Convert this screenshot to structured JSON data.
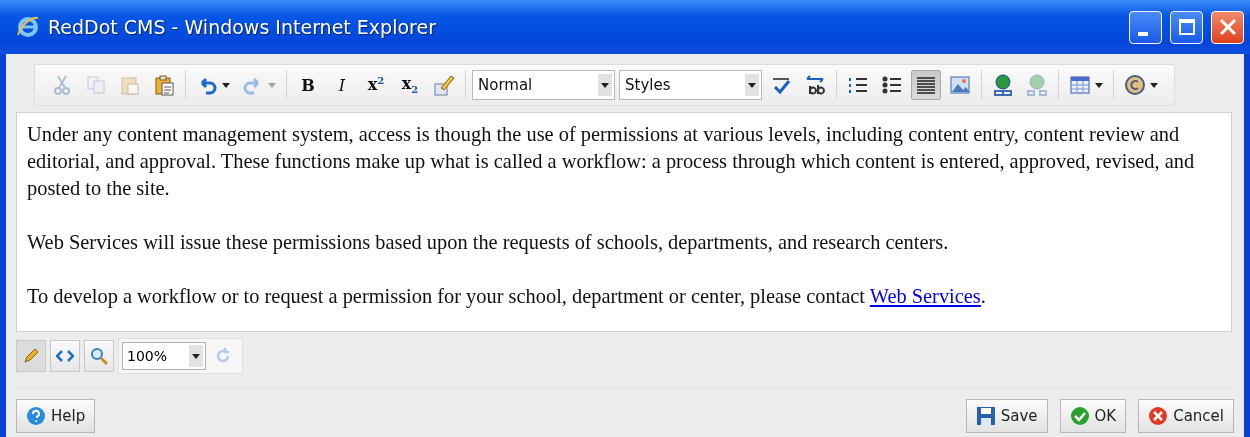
{
  "window": {
    "title": "RedDot CMS - Windows Internet Explorer"
  },
  "toolbar": [
    [
      {
        "kind": "button",
        "disabled": true,
        "pressed": false
      },
      {
        "kind": "button",
        "disabled": true,
        "pressed": false
      },
      {
        "kind": "button",
        "disabled": true,
        "pressed": false
      },
      {
        "kind": "button",
        "disabled": false,
        "pressed": false
      }
    ],
    [
      {
        "kind": "menubutton",
        "disabled": false,
        "pressed": false
      },
      {
        "kind": "menubutton",
        "disabled": true,
        "pressed": false
      }
    ],
    [
      {
        "kind": "glyph",
        "glyph": "B",
        "disabled": false,
        "pressed": false
      },
      {
        "kind": "glyph",
        "glyph": "I",
        "disabled": false,
        "pressed": false
      },
      {
        "kind": "glyph",
        "glyph": "x$^{2}$",
        "disabled": false,
        "pressed": false
      },
      {
        "kind": "glyph",
        "glyph": "x$_{2}$",
        "disabled": false,
        "pressed": false
      },
      {
        "kind": "button",
        "disabled": false,
        "pressed": false
      }
    ],
    [
      {
        "kind": "select",
        "value": "Normal"
      },
      {
        "kind": "select",
        "value": "Styles"
      },
      {
        "kind": "button",
        "disabled": false,
        "pressed": false
      },
      {
        "kind": "button",
        "disabled": false,
        "pressed": false
      }
    ],
    [
      {
        "kind": "button",
        "disabled": false,
        "pressed": false
      },
      {
        "kind": "button",
        "disabled": false,
        "pressed": false
      },
      {
        "kind": "button",
        "disabled": false,
        "pressed": true
      },
      {
        "kind": "button",
        "disabled": false,
        "pressed": false
      }
    ],
    [
      {
        "kind": "button",
        "disabled": false,
        "pressed": false
      },
      {
        "kind": "button",
        "disabled": true,
        "pressed": false
      }
    ],
    [
      {
        "kind": "menubutton",
        "disabled": false,
        "pressed": false
      }
    ],
    [
      {
        "kind": "menubutton",
        "disabled": false,
        "pressed": false
      }
    ]
  ],
  "content": [
    {
      "text": "Under any content management system, access is though the use of permissions at various levels, including content entry, content review and editorial, and approval. These functions make up what is called a workflow: a process through which content is entered, approved, revised, and posted to the site."
    },
    {
      "text": "Web Services will issue these permissions based upon the requests of schools, departments, and research centers."
    },
    {
      "text": "To develop a workflow or to request a permission for your school, department or center, please contact ",
      "link": "Web Services",
      "after": "."
    }
  ],
  "modes": [
    {
      "selected": true
    },
    {
      "selected": false
    },
    {
      "selected": false
    }
  ],
  "zoom": {
    "value": "100%"
  },
  "reset": {
    "disabled": true
  },
  "buttons": [
    {
      "label": "Help",
      "kind": "help"
    },
    {
      "label": "Save",
      "kind": "save"
    },
    {
      "label": "OK",
      "kind": "ok"
    },
    {
      "label": "Cancel",
      "kind": "cancel"
    }
  ]
}
